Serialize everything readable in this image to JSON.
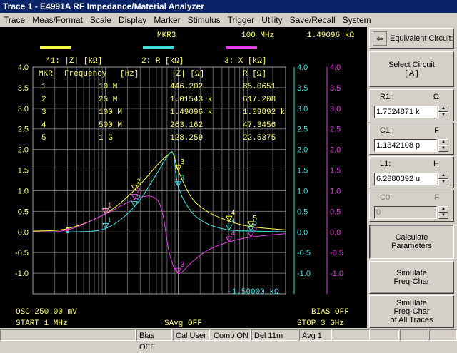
{
  "window": {
    "title": "Trace 1  -  E4991A RF Impedance/Material Analyzer"
  },
  "menu": [
    "Trace",
    "Meas/Format",
    "Scale",
    "Display",
    "Marker",
    "Stimulus",
    "Trigger",
    "Utility",
    "Save/Recall",
    "System"
  ],
  "screen": {
    "marker_header": {
      "name": "MKR3",
      "freq": "100 MHz",
      "value": "1.49096 kΩ"
    },
    "trace_labels": [
      "*1: |Z| [kΩ]",
      "2: R [kΩ]",
      "3: X [kΩ]"
    ],
    "table_headers": [
      "MKR",
      "Frequency",
      "[Hz]",
      "|Z| [Ω]",
      "R [Ω]"
    ],
    "table_rows": [
      {
        "mkr": "1",
        "freq": "10 M",
        "z": "446.202",
        "r": "85.0651"
      },
      {
        "mkr": "2",
        "freq": "25 M",
        "z": "1.01543 k",
        "r": "617.208"
      },
      {
        "mkr": "3",
        "freq": "100 M",
        "z": "1.49096 k",
        "r": "1.09892 k"
      },
      {
        "mkr": "4",
        "freq": "500 M",
        "z": "263.162",
        "r": "47.3456"
      },
      {
        "mkr": "5",
        "freq": "1 G",
        "z": "128.259",
        "r": "22.5375"
      }
    ],
    "x_readout": "-1.50000 kΩ",
    "osc": "OSC 250.00 mV",
    "bias": "BIAS OFF",
    "start": "START  1 MHz",
    "savg": "SAvg OFF",
    "stop": "STOP  3 GHz"
  },
  "panel": {
    "back_glyph": "⇦",
    "title": "Equivalent Circuit:",
    "select_circuit": "Select Circuit",
    "select_circuit_value": "[ A ]",
    "r1": {
      "label": "R1:",
      "unit": "Ω",
      "value": "1.7524871 k"
    },
    "c1": {
      "label": "C1:",
      "unit": "F",
      "value": "1.1342108 p"
    },
    "l1": {
      "label": "L1:",
      "unit": "H",
      "value": "6.2880392 u"
    },
    "c0": {
      "label": "C0:",
      "unit": "F",
      "value": "0"
    },
    "calc": [
      "Calculate",
      "Parameters"
    ],
    "sim": [
      "Simulate",
      "Freq-Char"
    ],
    "sim_all": [
      "Simulate",
      "Freq-Char",
      "of All Traces"
    ]
  },
  "status": [
    "Bias OFF",
    "Cal User",
    "Comp ON",
    "Del 11m",
    "Avg  1"
  ],
  "chart_data": {
    "type": "line",
    "x_scale": "log",
    "x_range": [
      1000000,
      3000000000
    ],
    "y_left_range": [
      -1.5,
      4.0
    ],
    "y_right_range": [
      -1.5,
      4.0
    ],
    "y_ticks": [
      "4.0",
      "3.5",
      "3.0",
      "2.5",
      "2.0",
      "1.5",
      "1.0",
      "0.5",
      "0.0",
      "-0.5",
      "-1.0"
    ],
    "grid": true,
    "series": [
      {
        "name": "|Z| [kΩ]",
        "color": "#ffff40",
        "x": [
          1000000,
          3000000,
          10000000,
          25000000,
          50000000,
          70000000,
          85000000,
          100000000,
          150000000,
          250000000,
          500000000,
          1000000000,
          3000000000
        ],
        "y": [
          0.02,
          0.08,
          0.446,
          1.015,
          1.6,
          1.85,
          1.9,
          1.491,
          0.85,
          0.5,
          0.263,
          0.128,
          0.05
        ]
      },
      {
        "name": "R [kΩ]",
        "color": "#40e0e0",
        "x": [
          1000000,
          3000000,
          10000000,
          25000000,
          50000000,
          70000000,
          85000000,
          100000000,
          150000000,
          250000000,
          500000000,
          1000000000,
          3000000000
        ],
        "y": [
          0.0,
          0.0,
          0.085,
          0.617,
          1.4,
          1.82,
          1.9,
          1.099,
          0.5,
          0.2,
          0.047,
          0.023,
          0.005
        ]
      },
      {
        "name": "X [kΩ]",
        "color": "#e040e0",
        "x": [
          1000000,
          3000000,
          10000000,
          25000000,
          45000000,
          60000000,
          75000000,
          100000000,
          150000000,
          250000000,
          500000000,
          1000000000,
          3000000000
        ],
        "y": [
          0.0,
          0.05,
          0.437,
          0.793,
          0.85,
          0.5,
          -0.5,
          -1.0,
          -0.75,
          -0.45,
          -0.24,
          -0.125,
          -0.04
        ]
      }
    ],
    "markers": [
      {
        "id": "1",
        "x": 10000000
      },
      {
        "id": "2",
        "x": 25000000
      },
      {
        "id": "3",
        "x": 100000000
      },
      {
        "id": "4",
        "x": 500000000
      },
      {
        "id": "5",
        "x": 1000000000
      }
    ]
  }
}
